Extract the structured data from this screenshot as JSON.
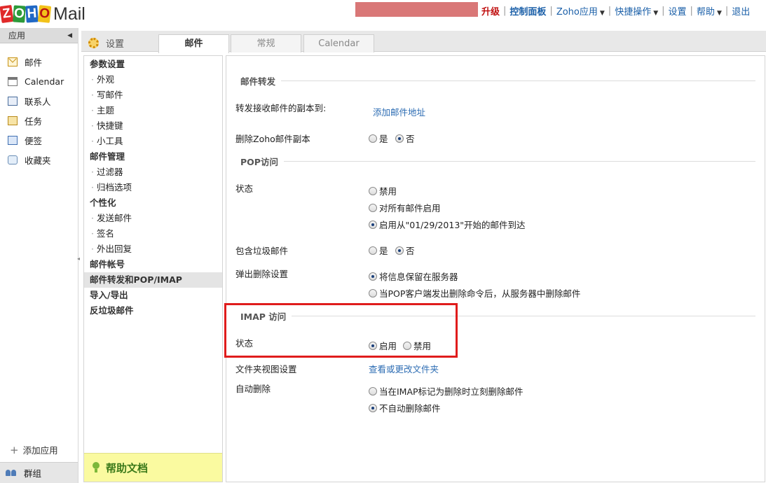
{
  "topbar": {
    "logo_letters": [
      "Z",
      "O",
      "H",
      "O"
    ],
    "logo_product": "Mail",
    "upgrade": "升级",
    "control_panel": "控制面板",
    "zoho_apps": "Zoho应用",
    "quick_actions": "快捷操作",
    "settings": "设置",
    "help": "帮助",
    "logout": "退出"
  },
  "sidebar": {
    "header": "应用",
    "items": [
      {
        "label": "邮件",
        "icon": "mail-icon"
      },
      {
        "label": "Calendar",
        "icon": "calendar-icon"
      },
      {
        "label": "联系人",
        "icon": "contacts-icon"
      },
      {
        "label": "任务",
        "icon": "tasks-icon"
      },
      {
        "label": "便签",
        "icon": "notes-icon"
      },
      {
        "label": "收藏夹",
        "icon": "bookmarks-icon"
      }
    ],
    "add_app": "添加应用",
    "groups": "群组"
  },
  "settings": {
    "title": "设置",
    "tabs": [
      "邮件",
      "常规",
      "Calendar"
    ],
    "active_tab": 0
  },
  "nav": [
    {
      "label": "参数设置",
      "type": "cat"
    },
    {
      "label": "外观",
      "type": "sub"
    },
    {
      "label": "写邮件",
      "type": "sub"
    },
    {
      "label": "主题",
      "type": "sub"
    },
    {
      "label": "快捷键",
      "type": "sub"
    },
    {
      "label": "小工具",
      "type": "sub"
    },
    {
      "label": "邮件管理",
      "type": "cat"
    },
    {
      "label": "过滤器",
      "type": "sub"
    },
    {
      "label": "归档选项",
      "type": "sub"
    },
    {
      "label": "个性化",
      "type": "cat"
    },
    {
      "label": "发送邮件",
      "type": "sub"
    },
    {
      "label": "签名",
      "type": "sub"
    },
    {
      "label": "外出回复",
      "type": "sub"
    },
    {
      "label": "邮件帐号",
      "type": "cat"
    },
    {
      "label": "邮件转发和POP/IMAP",
      "type": "cat",
      "selected": true
    },
    {
      "label": "导入/导出",
      "type": "cat"
    },
    {
      "label": "反垃圾邮件",
      "type": "cat"
    }
  ],
  "help_label": "帮助文档",
  "content": {
    "forwarding": {
      "heading": "邮件转发",
      "forward_label": "转发接收邮件的副本到:",
      "add_address": "添加邮件地址",
      "delete_copy_label": "删除Zoho邮件副本",
      "delete_copy_options": [
        "是",
        "否"
      ],
      "delete_copy_selected": "否"
    },
    "pop": {
      "heading": "POP访问",
      "status_label": "状态",
      "status_options": [
        "禁用",
        "对所有邮件启用",
        "启用从\"01/29/2013\"开始的邮件到达"
      ],
      "status_selected": "启用从\"01/29/2013\"开始的邮件到达",
      "spam_label": "包含垃圾邮件",
      "spam_options": [
        "是",
        "否"
      ],
      "spam_selected": "否",
      "expunge_label": "弹出删除设置",
      "expunge_options": [
        "将信息保留在服务器",
        "当POP客户端发出删除命令后，从服务器中删除邮件"
      ],
      "expunge_selected": "将信息保留在服务器"
    },
    "imap": {
      "heading": "IMAP 访问",
      "status_label": "状态",
      "status_options": [
        "启用",
        "禁用"
      ],
      "status_selected": "启用",
      "folder_view_label": "文件夹视图设置",
      "folder_view_link": "查看或更改文件夹",
      "auto_delete_label": "自动删除",
      "auto_delete_options": [
        "当在IMAP标记为删除时立刻删除邮件",
        "不自动删除邮件"
      ],
      "auto_delete_selected": "不自动删除邮件"
    }
  },
  "colors": {
    "highlight_box": "#e01c1c",
    "link": "#2c6cb3",
    "upgrade": "#c01010",
    "redaction": "#d97777"
  }
}
